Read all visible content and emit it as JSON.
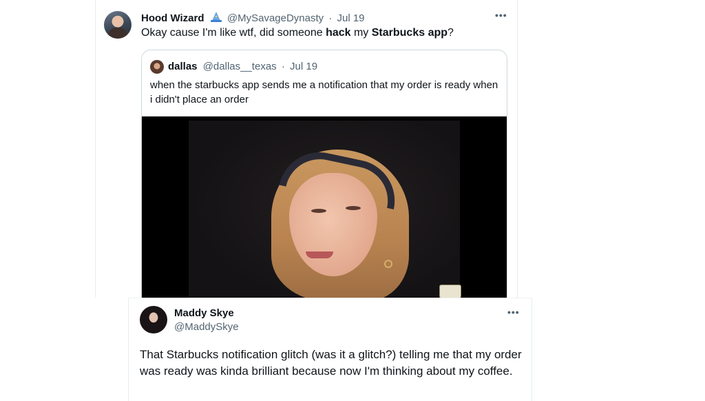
{
  "tweet": {
    "author_name": "Hood Wizard",
    "author_handle": "@MySavageDynasty",
    "date": "Jul 19",
    "text_part1": "Okay cause I'm like wtf, did someone ",
    "text_bold1": "hack",
    "text_part2": " my ",
    "text_bold2": "Starbucks app",
    "text_part3": "?",
    "more_label": "•••",
    "badge_icon": "wizard-hat-icon"
  },
  "quoted_tweet": {
    "author_name": "dallas",
    "author_handle": "@dallas__texas",
    "date": "Jul 19",
    "text": "when the starbucks app sends me a notification that my order is ready when i didn't place an order",
    "media_icon": "video-still-image"
  },
  "reply_tweet": {
    "author_name": "Maddy Skye",
    "author_handle": "@MaddySkye",
    "text": "That Starbucks notification glitch (was it a glitch?) telling me that my order was ready was kinda brilliant because now I'm thinking about my coffee.",
    "more_label": "•••"
  },
  "colors": {
    "text": "#0f1419",
    "muted": "#536471",
    "border": "#cfd9de"
  }
}
